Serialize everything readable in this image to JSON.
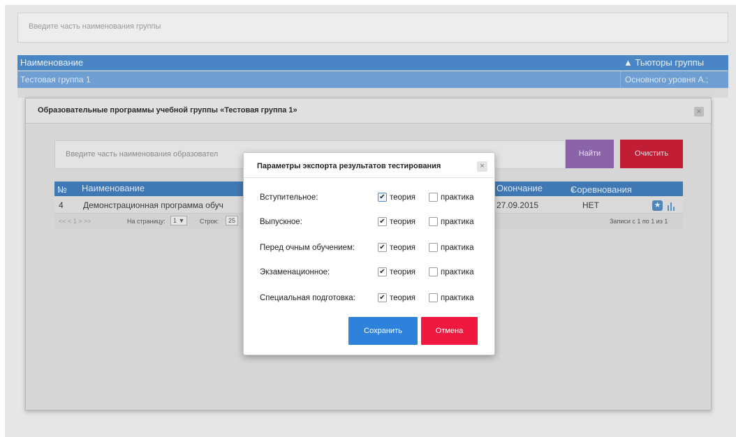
{
  "background": {
    "search_placeholder": "Введите часть наименования группы",
    "columns": {
      "name": "Наименование",
      "tutors": "Тьюторы группы"
    },
    "rows": [
      {
        "name": "Тестовая группа 1",
        "tutors": "Основного уровня А.;"
      }
    ]
  },
  "programs_modal": {
    "title": "Образовательные программы учебной группы «Тестовая группа 1»",
    "close_glyph": "×",
    "search_placeholder": "Введите часть наименования образовател",
    "find_label": "Найти",
    "clear_label": "Очистить",
    "columns": {
      "num": "№",
      "name": "Наименование",
      "end": "Окончание",
      "competitions": "Соревнования"
    },
    "rows": [
      {
        "num": "4",
        "name": "Демонстрационная программа обуч",
        "end": "27.09.2015",
        "competitions": "НЕТ"
      }
    ],
    "pager": {
      "nav_text": "<<  <  1  >  >>",
      "per_page_label": "На страницу:",
      "per_page_value": "1 ▼",
      "rows_label": "Строк:",
      "rows_value": "25",
      "records_text": "Записи с 1 по 1 из 1"
    }
  },
  "export_dialog": {
    "title": "Параметры экспорта результатов тестирования",
    "close_glyph": "×",
    "theory_label": "теория",
    "practice_label": "практика",
    "options": [
      {
        "label": "Вступительное:",
        "theory": true,
        "practice": false
      },
      {
        "label": "Выпускное:",
        "theory": true,
        "practice": false
      },
      {
        "label": "Перед очным обучением:",
        "theory": true,
        "practice": false
      },
      {
        "label": "Экзаменационное:",
        "theory": true,
        "practice": false
      },
      {
        "label": "Специальная подготовка:",
        "theory": true,
        "practice": false
      }
    ],
    "save_label": "Сохранить",
    "cancel_label": "Отмена"
  },
  "colors": {
    "header_blue": "#4a86c5",
    "find_purple": "#8a63a8",
    "clear_red": "#c11e35",
    "save_blue": "#2f82dc",
    "cancel_red": "#f0183f"
  }
}
